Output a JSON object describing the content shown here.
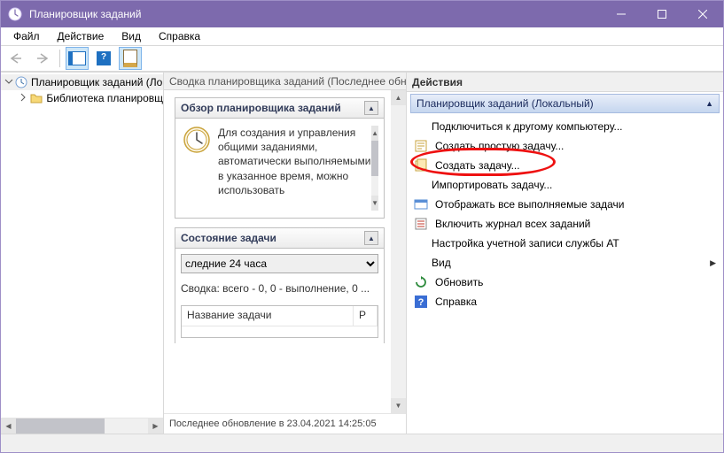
{
  "titlebar": {
    "title": "Планировщик заданий"
  },
  "menubar": {
    "file": "Файл",
    "action": "Действие",
    "view": "Вид",
    "help": "Справка"
  },
  "tree": {
    "root": "Планировщик заданий (Лок",
    "library": "Библиотека планировщ"
  },
  "middle": {
    "header": "Сводка планировщика заданий (Последнее обн",
    "overview_title": "Обзор планировщика заданий",
    "overview_text": "Для создания и управления общими заданиями, автоматически выполняемыми в указанное время, можно использовать",
    "status_title": "Состояние задачи",
    "status_select": "следние 24 часа",
    "status_summary": "Сводка: всего - 0, 0 - выполнение, 0 ...",
    "col_name": "Название задачи",
    "col_result": "Р",
    "last_update": "Последнее обновление в 23.04.2021 14:25:05"
  },
  "actions": {
    "pane_title": "Действия",
    "group_title": "Планировщик заданий (Локальный)",
    "items": {
      "connect": "Подключиться к другому компьютеру...",
      "basic_task": "Создать простую задачу...",
      "create_task": "Создать задачу...",
      "import": "Импортировать задачу...",
      "display_all": "Отображать все выполняемые задачи",
      "enable_log": "Включить журнал всех заданий",
      "at_account": "Настройка учетной записи службы AT",
      "view": "Вид",
      "refresh": "Обновить",
      "help": "Справка"
    }
  }
}
